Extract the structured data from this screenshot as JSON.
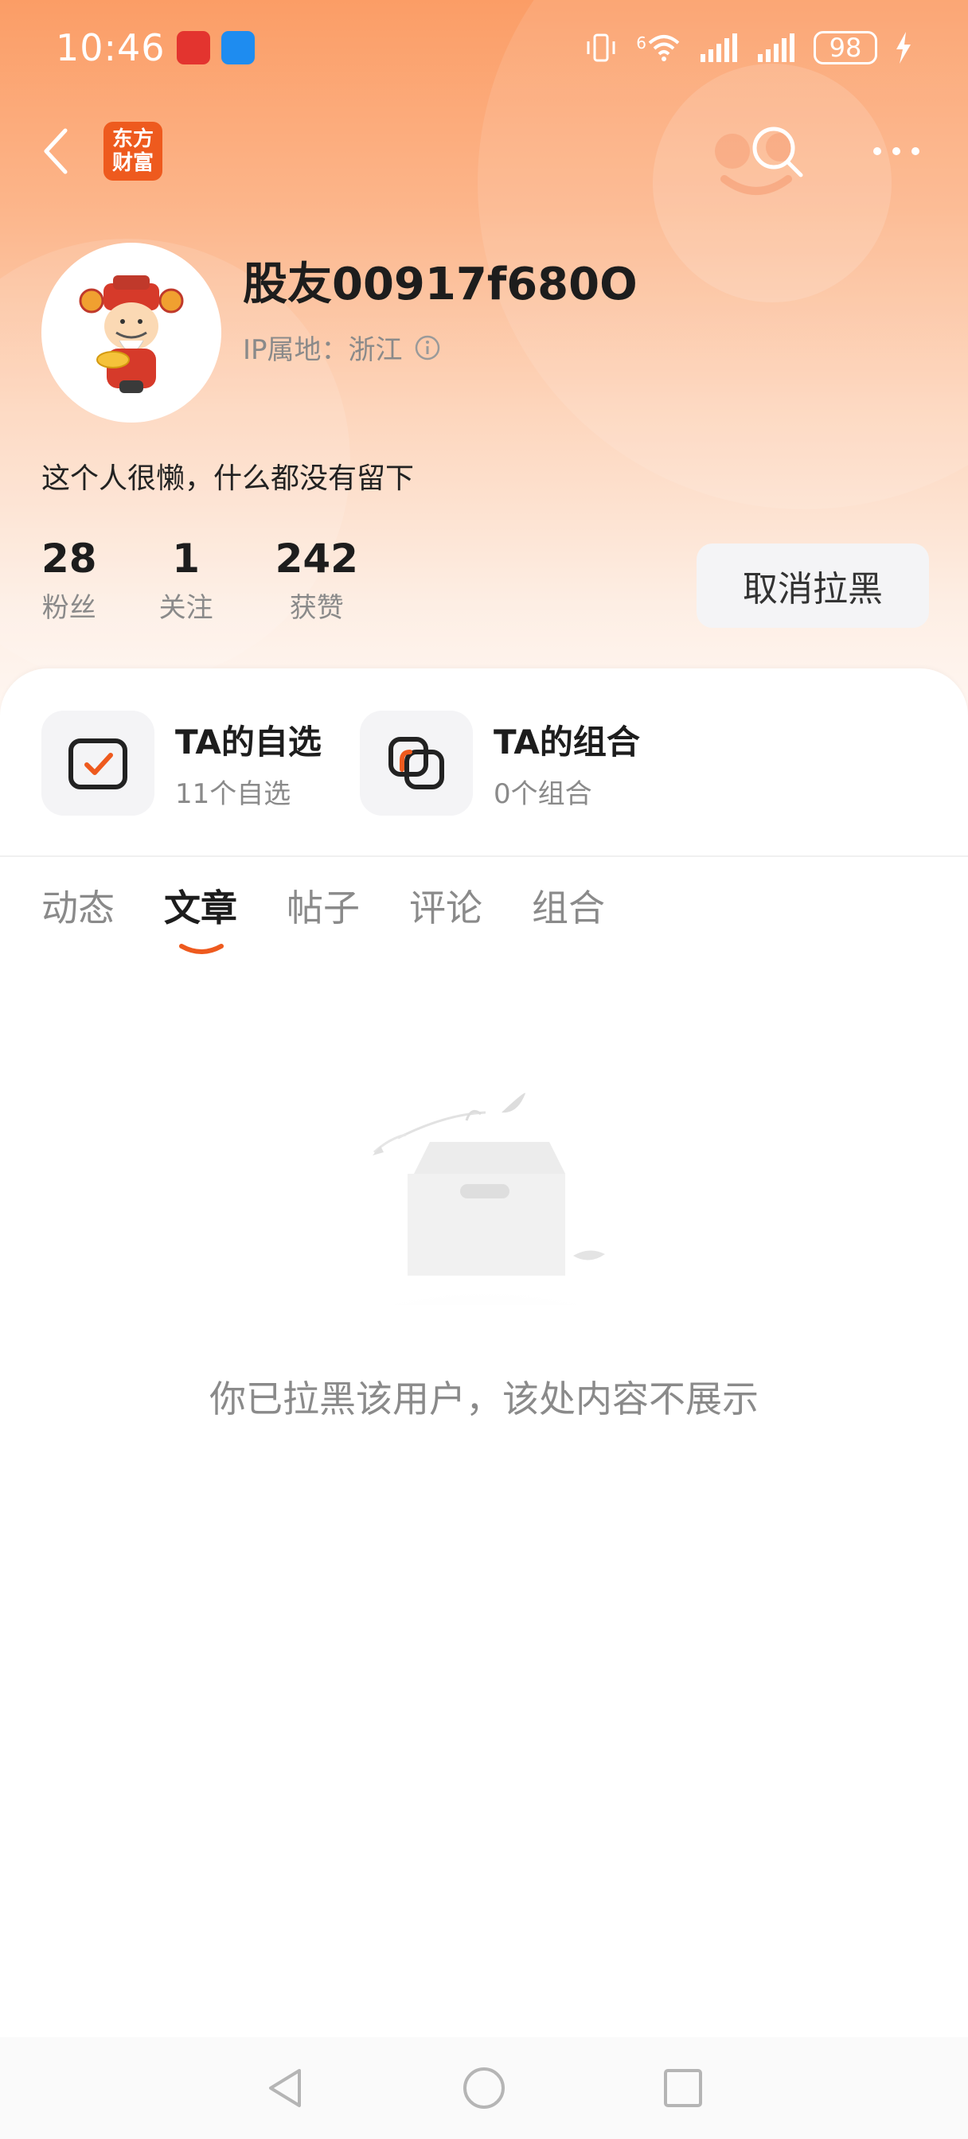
{
  "status_bar": {
    "time": "10:46",
    "network": "6",
    "battery": "98"
  },
  "nav": {
    "logo_line1": "东方",
    "logo_line2": "财富"
  },
  "profile": {
    "username": "股友00917f680O",
    "ip_location": "IP属地：浙江",
    "bio": "这个人很懒，什么都没有留下",
    "stats": [
      {
        "value": "28",
        "label": "粉丝"
      },
      {
        "value": "1",
        "label": "关注"
      },
      {
        "value": "242",
        "label": "获赞"
      }
    ],
    "unblock_label": "取消拉黑"
  },
  "features": [
    {
      "title": "TA的自选",
      "subtitle": "11个自选"
    },
    {
      "title": "TA的组合",
      "subtitle": "0个组合"
    }
  ],
  "tabs": [
    {
      "label": "动态"
    },
    {
      "label": "文章"
    },
    {
      "label": "帖子"
    },
    {
      "label": "评论"
    },
    {
      "label": "组合"
    }
  ],
  "active_tab": "文章",
  "empty_message": "你已拉黑该用户，该处内容不展示",
  "colors": {
    "accent": "#ee5a1e",
    "header_gradient_top": "#fb9d66",
    "muted_text": "#8a8a8a"
  },
  "icons": {
    "back": "chevron-left-icon",
    "search": "search-icon",
    "more": "more-dots-icon",
    "info": "info-icon",
    "watchlist": "checkbox-check-icon",
    "portfolio": "overlapping-squares-icon"
  }
}
